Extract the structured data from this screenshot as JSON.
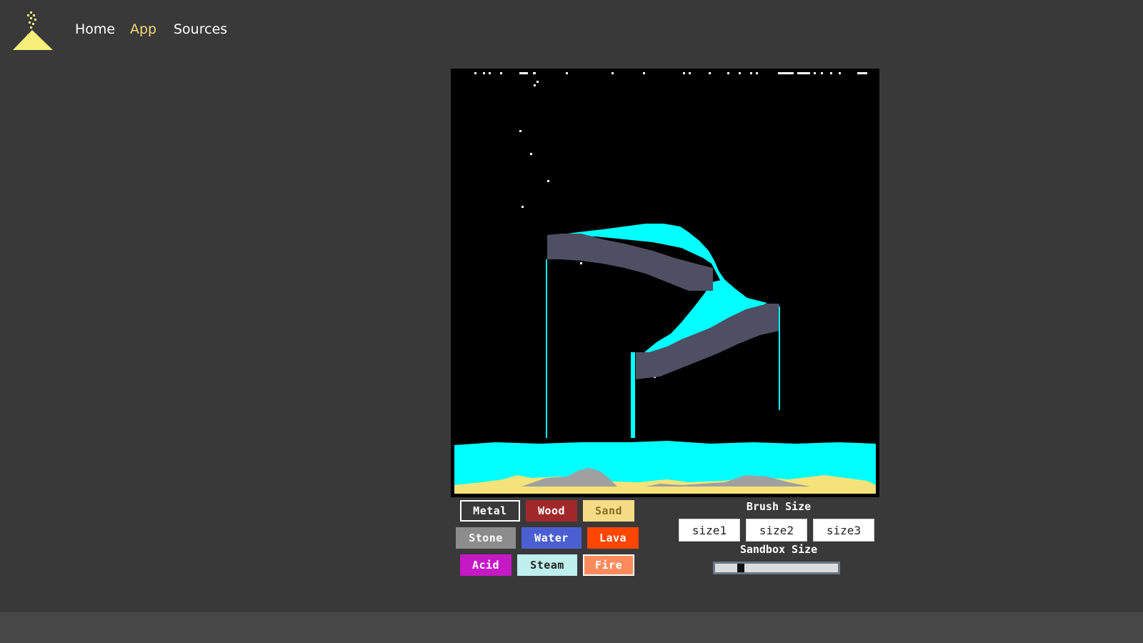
{
  "nav": {
    "links": [
      "Home",
      "App",
      "Sources"
    ],
    "active": "App"
  },
  "logo": {
    "icon": "sand-pile-logo-icon",
    "color": "#f6f07a"
  },
  "sandbox": {
    "background": "#000000",
    "colors": {
      "water": "#00ffff",
      "metal": "#4f4f63",
      "sand": "#f6e27a",
      "stone": "#a0a0a0",
      "steam": "#ffffff"
    }
  },
  "elements": [
    {
      "label": "Metal",
      "bg": "#393939",
      "fg": "#ffffff",
      "border": "#ffffff"
    },
    {
      "label": "Wood",
      "bg": "#a0282a",
      "fg": "#ffffff",
      "border": "#a0282a"
    },
    {
      "label": "Sand",
      "bg": "#f7dc86",
      "fg": "#8a6a2a",
      "border": "#f7dc86"
    },
    {
      "label": "Stone",
      "bg": "#8c8c8c",
      "fg": "#ffffff",
      "border": "#8c8c8c"
    },
    {
      "label": "Water",
      "bg": "#4b5fd3",
      "fg": "#ffffff",
      "border": "#4b5fd3"
    },
    {
      "label": "Lava",
      "bg": "#ff4500",
      "fg": "#ffffff",
      "border": "#ff4500"
    },
    {
      "label": "Acid",
      "bg": "#c619c6",
      "fg": "#ffffff",
      "border": "#c619c6"
    },
    {
      "label": "Steam",
      "bg": "#bff0ee",
      "fg": "#222222",
      "border": "#bff0ee"
    },
    {
      "label": "Fire",
      "bg": "#ff8a5c",
      "fg": "#ffffff",
      "border": "#ffffff"
    }
  ],
  "brush": {
    "title": "Brush Size",
    "sizes": [
      "size1",
      "size2",
      "size3"
    ]
  },
  "sandbox_size": {
    "title": "Sandbox Size",
    "value_fraction": 0.25
  }
}
